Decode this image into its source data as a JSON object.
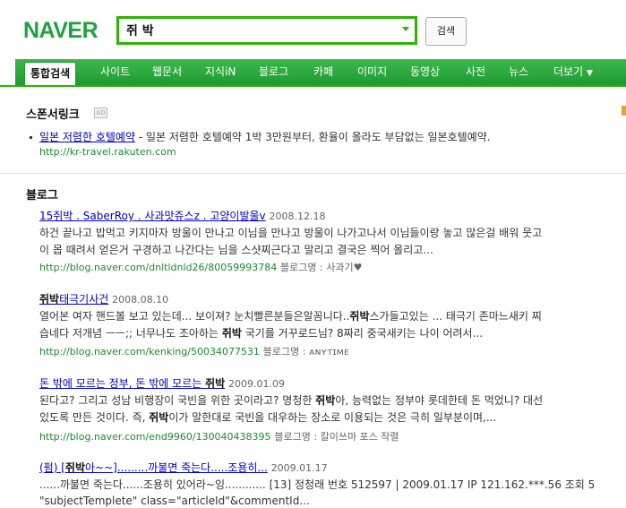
{
  "header": {
    "logo": "NAVER",
    "search_value": "쥐 박",
    "search_button": "검색"
  },
  "tabs": [
    {
      "label": "통합검색",
      "active": true
    },
    {
      "label": "사이트"
    },
    {
      "label": "웹문서"
    },
    {
      "label": "지식iN"
    },
    {
      "label": "블로그"
    },
    {
      "label": "카페"
    },
    {
      "label": "이미지"
    },
    {
      "label": "동영상"
    },
    {
      "label": "사전"
    },
    {
      "label": "뉴스"
    },
    {
      "label": "더보기"
    }
  ],
  "sponsored": {
    "title": "스폰서링크",
    "badge": "AD",
    "item": {
      "link": "일본 저렴한 호텔예약",
      "desc": " - 일본 저렴한 호텔예약 1박 3만원부터, 환율이 올라도 부담없는 일본호텔예약.",
      "url": "http://kr-travel.rakuten.com"
    }
  },
  "blog": {
    "title": "블로그",
    "meta_label": "블로그명 : ",
    "items": [
      {
        "title": "15쥐박 . SaberRoy . 사과맛쥬스z . 고양이발울v",
        "date": "2008.12.18",
        "line1": "하건 끝나고 밥먹고 키지마자 방울이 만나고 이님을 만나고 방울이 나가고나서 이님들이랑 놓고 많은걸 배워 웃고",
        "line2": "이 몹 때려서 얻은거 구경하고 나간다는 님을 스샷찌근다고 말리고 결국은 찍어 올리고...",
        "url": "http://blog.naver.com/dnltldnld26/80059993784",
        "blog_name": "사과기♥"
      },
      {
        "title_b": "쥐박",
        "title_rest": "태극기사건",
        "date": "2008.08.10",
        "line1a": "열어본 여자 핸드볼 보고 있는데... 보이져? 눈치빨른분들은알꼼니다..",
        "line1b": "쥐박",
        "line1c": "스가들고있는 ... 태극기 존마느새키 찌",
        "line2a": "습네다 저개념 ㅡㅡ;; 너무나도 조아하는 ",
        "line2b": "쥐박",
        "line2c": " 국기를 거꾸로드님? 8짜리 중국새키는 나이 어려서...",
        "url": "http://blog.naver.com/kenking/50034077531",
        "blog_name": "ᴀɴʏᴛɪᴍᴇ"
      },
      {
        "title_a": "돈 밖에 모르는 정부, 돈 밖에 모르는 ",
        "title_b": "쥐박",
        "date": "2009.01.09",
        "line1a": "된다고? 그리고 성남 비행장이 국빈을 위한 곳이라고? 명청한 ",
        "line1b": "쥐박",
        "line1c": "아, 능력없는 정부야 롯데한테 돈 먹었니? 대선",
        "line2a": "있도록 만든 것이다. 즉, ",
        "line2b": "쥐박",
        "line2c": "이가 말한대로 국빈을 대우하는 장소로 이용되는 것은 극히 일부분이며,...",
        "url": "http://blog.naver.com/end9960/130040438395",
        "blog_name": "칼이쓰마 포스 작렬"
      },
      {
        "title_a": "(펌) [",
        "title_b": "쥐박",
        "title_c": "아~~].........까불면 죽는다.....조용히...",
        "date": "2009.01.17",
        "line1": "......까불면 죽는다......조용히 있어라~잉............  [13] 정청래 번호 512597 | 2009.01.17 IP 121.162.***.56 조회 5",
        "line2": "\"subjectTemplete\" class=\"articleId\"&commentId..."
      }
    ]
  }
}
